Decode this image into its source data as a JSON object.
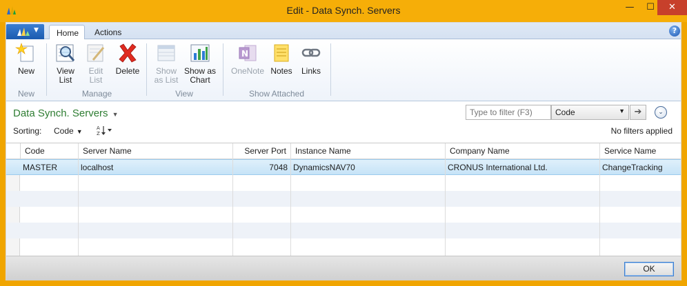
{
  "window": {
    "title": "Edit - Data Synch. Servers",
    "minimize": "—",
    "maximize": "☐",
    "close": "✕"
  },
  "ribbon": {
    "tabs": [
      "Home",
      "Actions"
    ],
    "groups": {
      "new": {
        "label": "New",
        "buttons": [
          {
            "label": "New",
            "enabled": true
          }
        ]
      },
      "manage": {
        "label": "Manage",
        "buttons": [
          {
            "line1": "View",
            "line2": "List",
            "enabled": true
          },
          {
            "line1": "Edit",
            "line2": "List",
            "enabled": false
          },
          {
            "line1": "Delete",
            "line2": "",
            "enabled": true
          }
        ]
      },
      "view": {
        "label": "View",
        "buttons": [
          {
            "line1": "Show",
            "line2": "as List",
            "enabled": false
          },
          {
            "line1": "Show as",
            "line2": "Chart",
            "enabled": true
          }
        ]
      },
      "show_attached": {
        "label": "Show Attached",
        "buttons": [
          {
            "label": "OneNote",
            "enabled": false
          },
          {
            "label": "Notes",
            "enabled": true
          },
          {
            "label": "Links",
            "enabled": true
          }
        ]
      }
    }
  },
  "page": {
    "title": "Data Synch. Servers",
    "filter_placeholder": "Type to filter (F3)",
    "filter_field": "Code",
    "sorting_label": "Sorting:",
    "sort_field": "Code",
    "no_filters": "No filters applied"
  },
  "table": {
    "columns": [
      "Code",
      "Server Name",
      "Server Port",
      "Instance Name",
      "Company Name",
      "Service Name"
    ],
    "rows": [
      {
        "code": "MASTER",
        "server_name": "localhost",
        "server_port": "7048",
        "instance_name": "DynamicsNAV70",
        "company_name": "CRONUS International Ltd.",
        "service_name": "ChangeTracking"
      }
    ]
  },
  "footer": {
    "ok_label": "OK"
  },
  "colors": {
    "frame": "#f6ae08",
    "page_title": "#2e7d32",
    "selection": "#c6e3f7",
    "close_button": "#c7402b"
  }
}
